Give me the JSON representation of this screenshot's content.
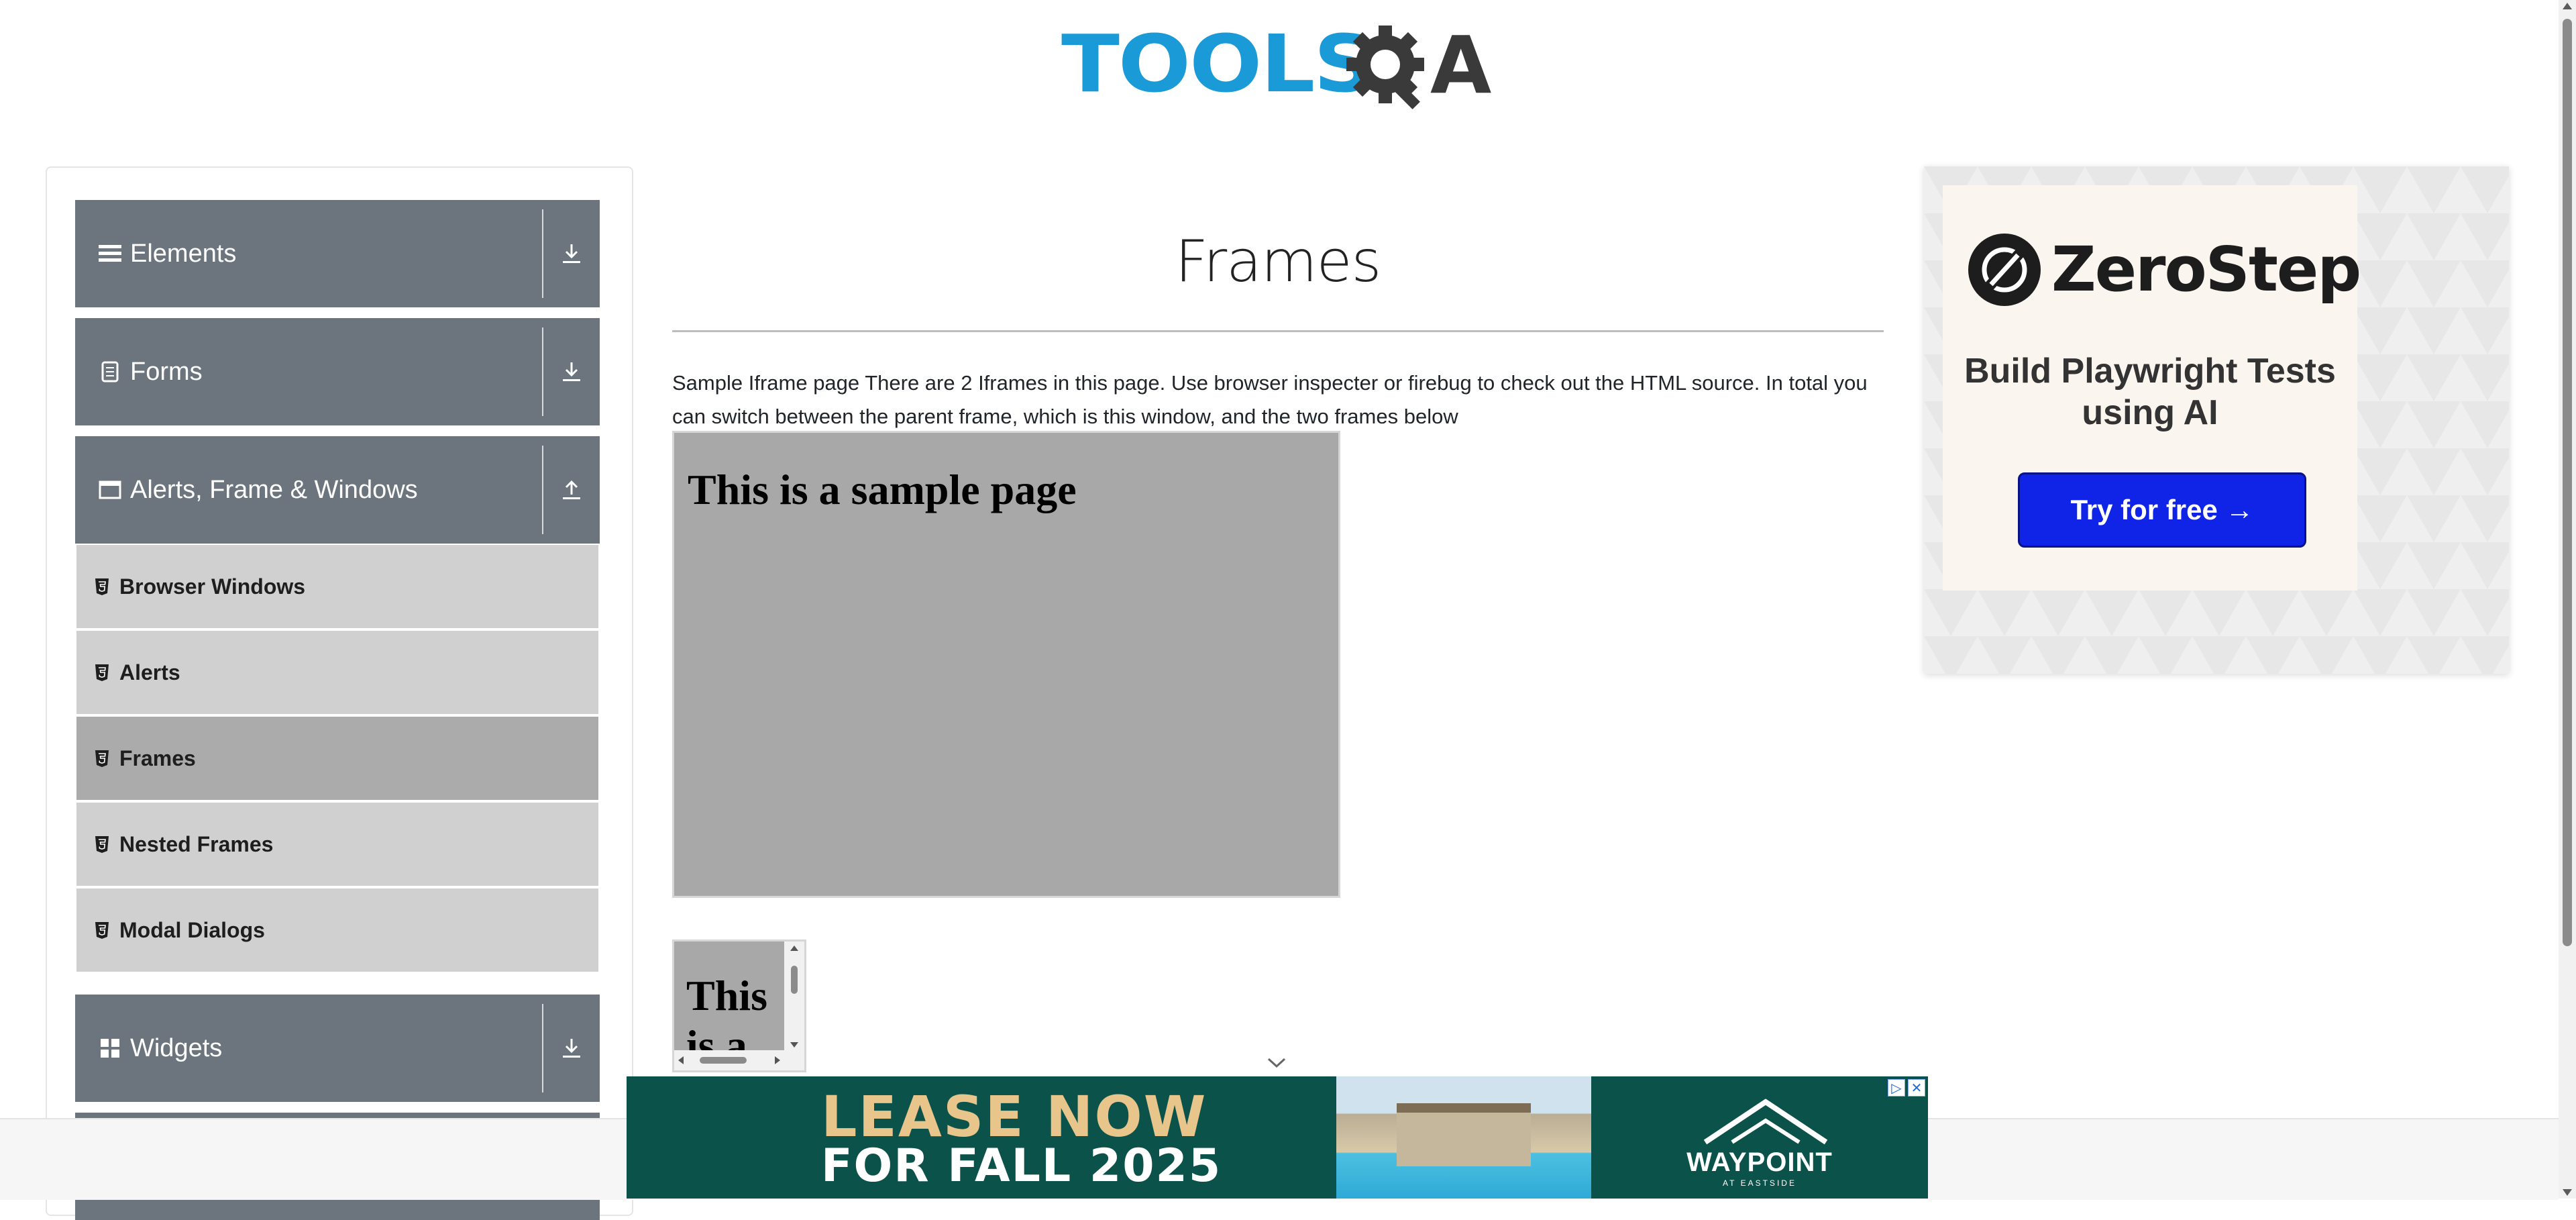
{
  "logo": {
    "text_main": "TOOLS",
    "text_q": "Q",
    "text_a": "A",
    "brand_color": "#1a9ad6",
    "dark_color": "#3a3a3a"
  },
  "sidebar": {
    "groups": [
      {
        "label": "Elements",
        "icon": "hamburger-icon",
        "arrow": "download-icon"
      },
      {
        "label": "Forms",
        "icon": "document-icon",
        "arrow": "download-icon"
      },
      {
        "label": "Alerts, Frame & Windows",
        "icon": "window-icon",
        "arrow": "upload-icon",
        "expanded": true
      },
      {
        "label": "Widgets",
        "icon": "grid-icon",
        "arrow": "download-icon"
      }
    ],
    "items": [
      {
        "label": "Browser Windows",
        "icon": "html5-icon"
      },
      {
        "label": "Alerts",
        "icon": "html5-icon"
      },
      {
        "label": "Frames",
        "icon": "html5-icon",
        "active": true
      },
      {
        "label": "Nested Frames",
        "icon": "html5-icon"
      },
      {
        "label": "Modal Dialogs",
        "icon": "html5-icon"
      }
    ],
    "header_color": "#6c757d",
    "item_color": "#d0d0d0",
    "active_item_color": "#ababab"
  },
  "main": {
    "title": "Frames",
    "intro": "Sample Iframe page There are 2 Iframes in this page. Use browser inspecter or firebug to check out the HTML source. In total you can switch between the parent frame, which is this window, and the two frames below",
    "frame1": {
      "heading": "This is a sample page"
    },
    "frame2": {
      "heading": "This is a sample page"
    }
  },
  "ad_right": {
    "brand": "ZeroStep",
    "tagline": "Build Playwright Tests using AI",
    "cta": "Try for free →",
    "cta_color": "#0f24e6"
  },
  "ad_bottom": {
    "line1": "LEASE NOW",
    "line2": "FOR FALL 2025",
    "brand": "WAYPOINT",
    "brand_sub": "AT EASTSIDE",
    "bg_color": "#0b524a"
  }
}
